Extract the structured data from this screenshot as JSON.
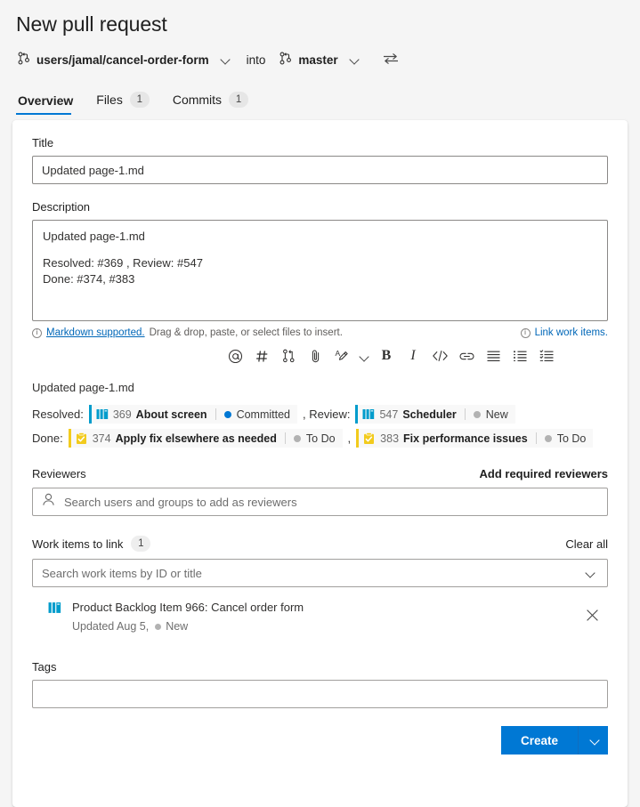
{
  "header": {
    "title": "New pull request",
    "source_branch": "users/jamal/cancel-order-form",
    "into_label": "into",
    "target_branch": "master",
    "branch_icon": "git-branch-icon",
    "swap_icon": "swap-branches-icon"
  },
  "tabs": [
    {
      "label": "Overview",
      "count": "",
      "active": true
    },
    {
      "label": "Files",
      "count": "1",
      "active": false
    },
    {
      "label": "Commits",
      "count": "1",
      "active": false
    }
  ],
  "form": {
    "title_label": "Title",
    "title_value": "Updated page-1.md",
    "title_placeholder": "",
    "description_label": "Description",
    "description_line1": "Updated page-1.md",
    "description_line2": "Resolved: #369 , Review: #547",
    "description_line3": "Done: #374, #383",
    "markdown_link": "Markdown supported.",
    "markdown_hint": "Drag & drop, paste, or select files to insert.",
    "link_work_items": "Link work items."
  },
  "toolbar": [
    {
      "name": "mention-icon",
      "glyph": "@"
    },
    {
      "name": "work-item-hash-icon",
      "glyph": "#"
    },
    {
      "name": "pull-request-icon",
      "glyph": ""
    },
    {
      "name": "attach-file-icon",
      "glyph": ""
    },
    {
      "name": "highlight-pen-icon",
      "glyph": ""
    },
    {
      "name": "highlight-dropdown-icon",
      "glyph": ""
    },
    {
      "name": "bold-icon",
      "glyph": "B"
    },
    {
      "name": "italic-icon",
      "glyph": "I"
    },
    {
      "name": "code-icon",
      "glyph": "</>"
    },
    {
      "name": "link-icon",
      "glyph": ""
    },
    {
      "name": "bulleted-list-icon",
      "glyph": ""
    },
    {
      "name": "numbered-list-icon",
      "glyph": ""
    },
    {
      "name": "task-list-icon",
      "glyph": ""
    }
  ],
  "work_item_preview": {
    "filename": "Updated page-1.md",
    "lines": [
      {
        "prefix": "Resolved:",
        "chips": [
          {
            "type": "Product Backlog Item",
            "icon": "product-backlog-item-icon",
            "accent": "#009ccc",
            "id": "369",
            "title": "About screen",
            "state": "Committed",
            "state_color": "#0078d4"
          }
        ],
        "separator": ", Review:",
        "chips2": [
          {
            "type": "Product Backlog Item",
            "icon": "product-backlog-item-icon",
            "accent": "#009ccc",
            "id": "547",
            "title": "Scheduler",
            "state": "New",
            "state_color": "#b2b2b2"
          }
        ]
      },
      {
        "prefix": "Done:",
        "chips": [
          {
            "type": "Task",
            "icon": "task-icon",
            "accent": "#f2cb1d",
            "id": "374",
            "title": "Apply fix elsewhere as needed",
            "state": "To Do",
            "state_color": "#b2b2b2"
          }
        ],
        "separator": ",",
        "chips2": [
          {
            "type": "Task",
            "icon": "task-icon",
            "accent": "#f2cb1d",
            "id": "383",
            "title": "Fix performance issues",
            "state": "To Do",
            "state_color": "#b2b2b2"
          }
        ]
      }
    ]
  },
  "reviewers": {
    "label": "Reviewers",
    "action": "Add required reviewers",
    "placeholder": "Search users and groups to add as reviewers",
    "icon": "person-icon"
  },
  "work_items": {
    "label": "Work items to link",
    "count": "1",
    "action": "Clear all",
    "placeholder": "Search work items by ID or title",
    "linked": [
      {
        "icon": "product-backlog-item-icon",
        "title": "Product Backlog Item 966: Cancel order form",
        "updated": "Updated Aug 5,",
        "state": "New",
        "remove_icon": "close-icon"
      }
    ]
  },
  "tags": {
    "label": "Tags",
    "value": "",
    "placeholder": ""
  },
  "footer": {
    "create_label": "Create",
    "create_dropdown_icon": "chevron-down-icon"
  },
  "colors": {
    "accent": "#0078d4",
    "page_bg": "#f5f5f5",
    "card_bg": "#ffffff",
    "pbi_blue": "#009ccc",
    "task_yellow": "#f2cb1d",
    "link": "#0067b8"
  }
}
